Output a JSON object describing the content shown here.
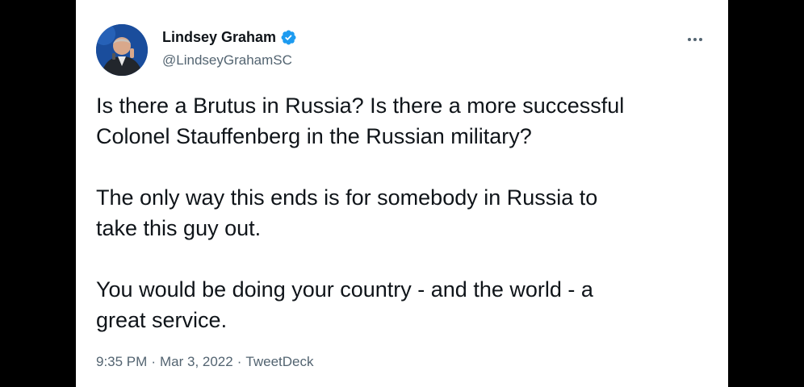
{
  "tweet": {
    "author": {
      "display_name": "Lindsey Graham",
      "handle": "@LindseyGrahamSC",
      "verified": true,
      "avatar_icon": "profile-photo"
    },
    "more_icon": "ellipsis-icon",
    "paragraphs": [
      "Is there a Brutus in Russia?  Is there a more successful\nColonel Stauffenberg in the Russian military?",
      "The only way this ends is for somebody in Russia to\ntake this guy out.",
      "You would be doing your country - and the world - a\ngreat service."
    ],
    "meta": {
      "time": "9:35 PM",
      "separator": "·",
      "date": "Mar 3, 2022",
      "source": "TweetDeck"
    }
  },
  "colors": {
    "text": "#0f1419",
    "muted": "#536471",
    "verified_blue": "#1d9bf0",
    "background": "#ffffff",
    "letterbox": "#000000"
  }
}
